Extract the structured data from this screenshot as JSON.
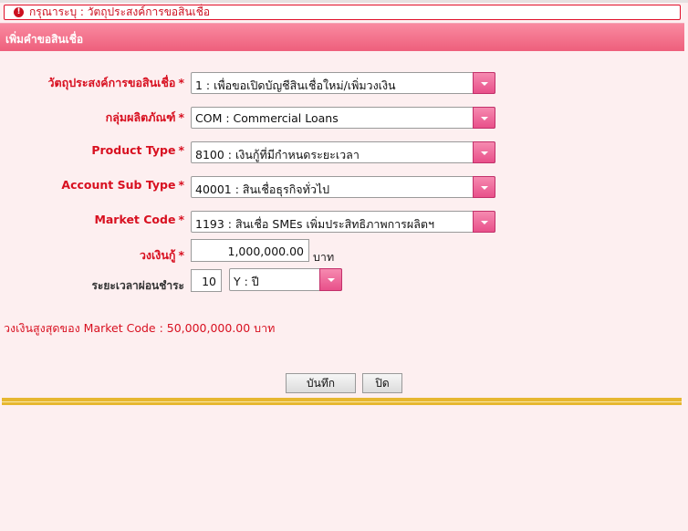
{
  "alert": {
    "icon": "exclamation-icon",
    "text": "กรุณาระบุ : วัตถุประสงค์การขอสินเชื่อ"
  },
  "header": {
    "title": "เพิ่มคำขอสินเชื่อ"
  },
  "form": {
    "purpose": {
      "label": "วัตถุประสงค์การขอสินเชื่อ",
      "required": "*",
      "value": "1 : เพื่อขอเปิดบัญชีสินเชื่อใหม่/เพิ่มวงเงิน"
    },
    "product_group": {
      "label": "กลุ่มผลิตภัณฑ์",
      "required": "*",
      "value": "COM : Commercial Loans"
    },
    "product_type": {
      "label": "Product Type",
      "required": "*",
      "value": "8100 : เงินกู้ที่มีกำหนดระยะเวลา"
    },
    "account_sub_type": {
      "label": "Account Sub Type",
      "required": "*",
      "value": "40001 : สินเชื่อธุรกิจทั่วไป"
    },
    "market_code": {
      "label": "Market Code",
      "required": "*",
      "value": "1193 : สินเชื่อ SMEs เพิ่มประสิทธิภาพการผลิตฯ"
    },
    "credit_limit": {
      "label": "วงเงินกู้",
      "required": "*",
      "value": "1,000,000.00",
      "unit": "บาท"
    },
    "repayment_period": {
      "label": "ระยะเวลาผ่อนชำระ",
      "value": "10",
      "unit_value": "Y : ปี"
    }
  },
  "max_note": "วงเงินสูงสุดของ Market Code : 50,000,000.00 บาท",
  "buttons": {
    "save": "บันทึก",
    "close": "ปิด"
  },
  "colors": {
    "header": "#ee5f7c",
    "required": "#d81020",
    "dropdown_button": "#e8508a",
    "gold_bar": "#e6b730",
    "background": "#fdeff0"
  }
}
